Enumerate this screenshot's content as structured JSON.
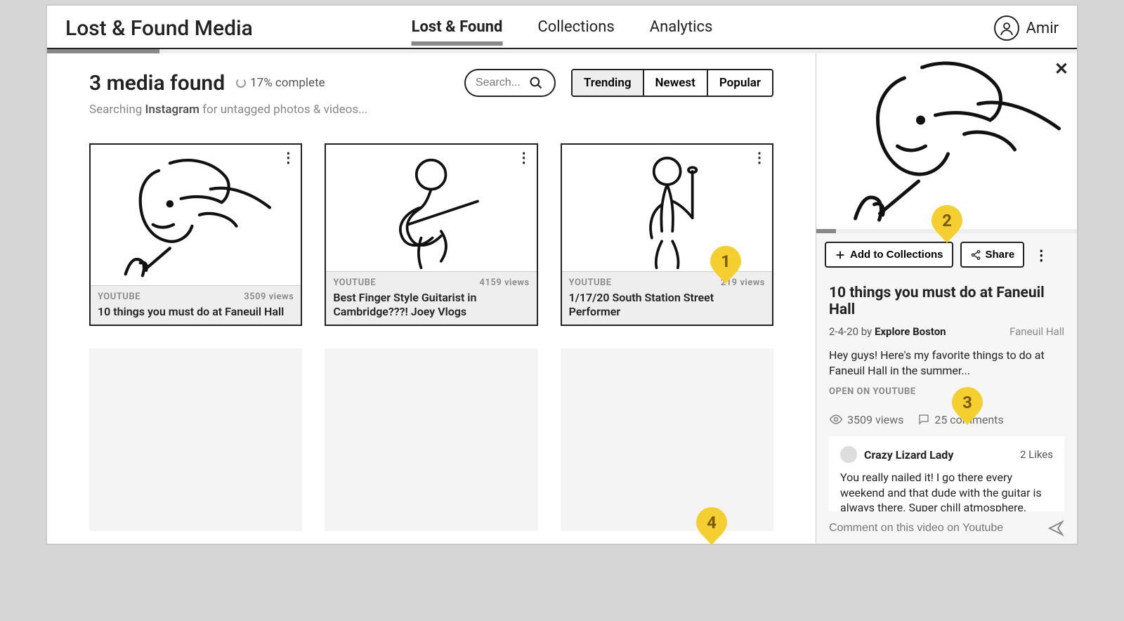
{
  "header": {
    "logo": "Lost & Found Media",
    "tabs": [
      "Lost & Found",
      "Collections",
      "Analytics"
    ],
    "active_tab": 0,
    "user_name": "Amir"
  },
  "main": {
    "title": "3 media found",
    "complete_label": "17% complete",
    "subtitle_prefix": "Searching ",
    "subtitle_bold": "Instagram",
    "subtitle_suffix": " for untagged photos & videos...",
    "search_placeholder": "Search...",
    "filters": [
      "Trending",
      "Newest",
      "Popular"
    ],
    "active_filter": 0,
    "cards": [
      {
        "source": "YOUTUBE",
        "views": "3509 views",
        "title": "10 things you must do at Faneuil Hall"
      },
      {
        "source": "YOUTUBE",
        "views": "4159 views",
        "title": "Best Finger Style Guitarist in Cambridge???! Joey Vlogs"
      },
      {
        "source": "YOUTUBE",
        "views": "219 views",
        "title": "1/17/20 South Station Street Performer"
      }
    ]
  },
  "side": {
    "add_label": "Add to Collections",
    "share_label": "Share",
    "title": "10 things you must do at Faneuil Hall",
    "date": "2-4-20",
    "by_word": "by",
    "author": "Explore Boston",
    "location": "Faneuil Hall",
    "description": "Hey guys! Here's my favorite things to do at Faneuil Hall in the summer...",
    "open_link": "OPEN ON YOUTUBE",
    "views_label": "3509 views",
    "comments_label": "25 comments",
    "comment": {
      "user": "Crazy Lizard Lady",
      "likes": "2 Likes",
      "text": "You really nailed it! I go there every weekend and that dude with the guitar is always there. Super chill atmosphere."
    },
    "comment_placeholder": "Comment on this video on Youtube"
  },
  "bubbles": [
    "1",
    "2",
    "3",
    "4"
  ]
}
